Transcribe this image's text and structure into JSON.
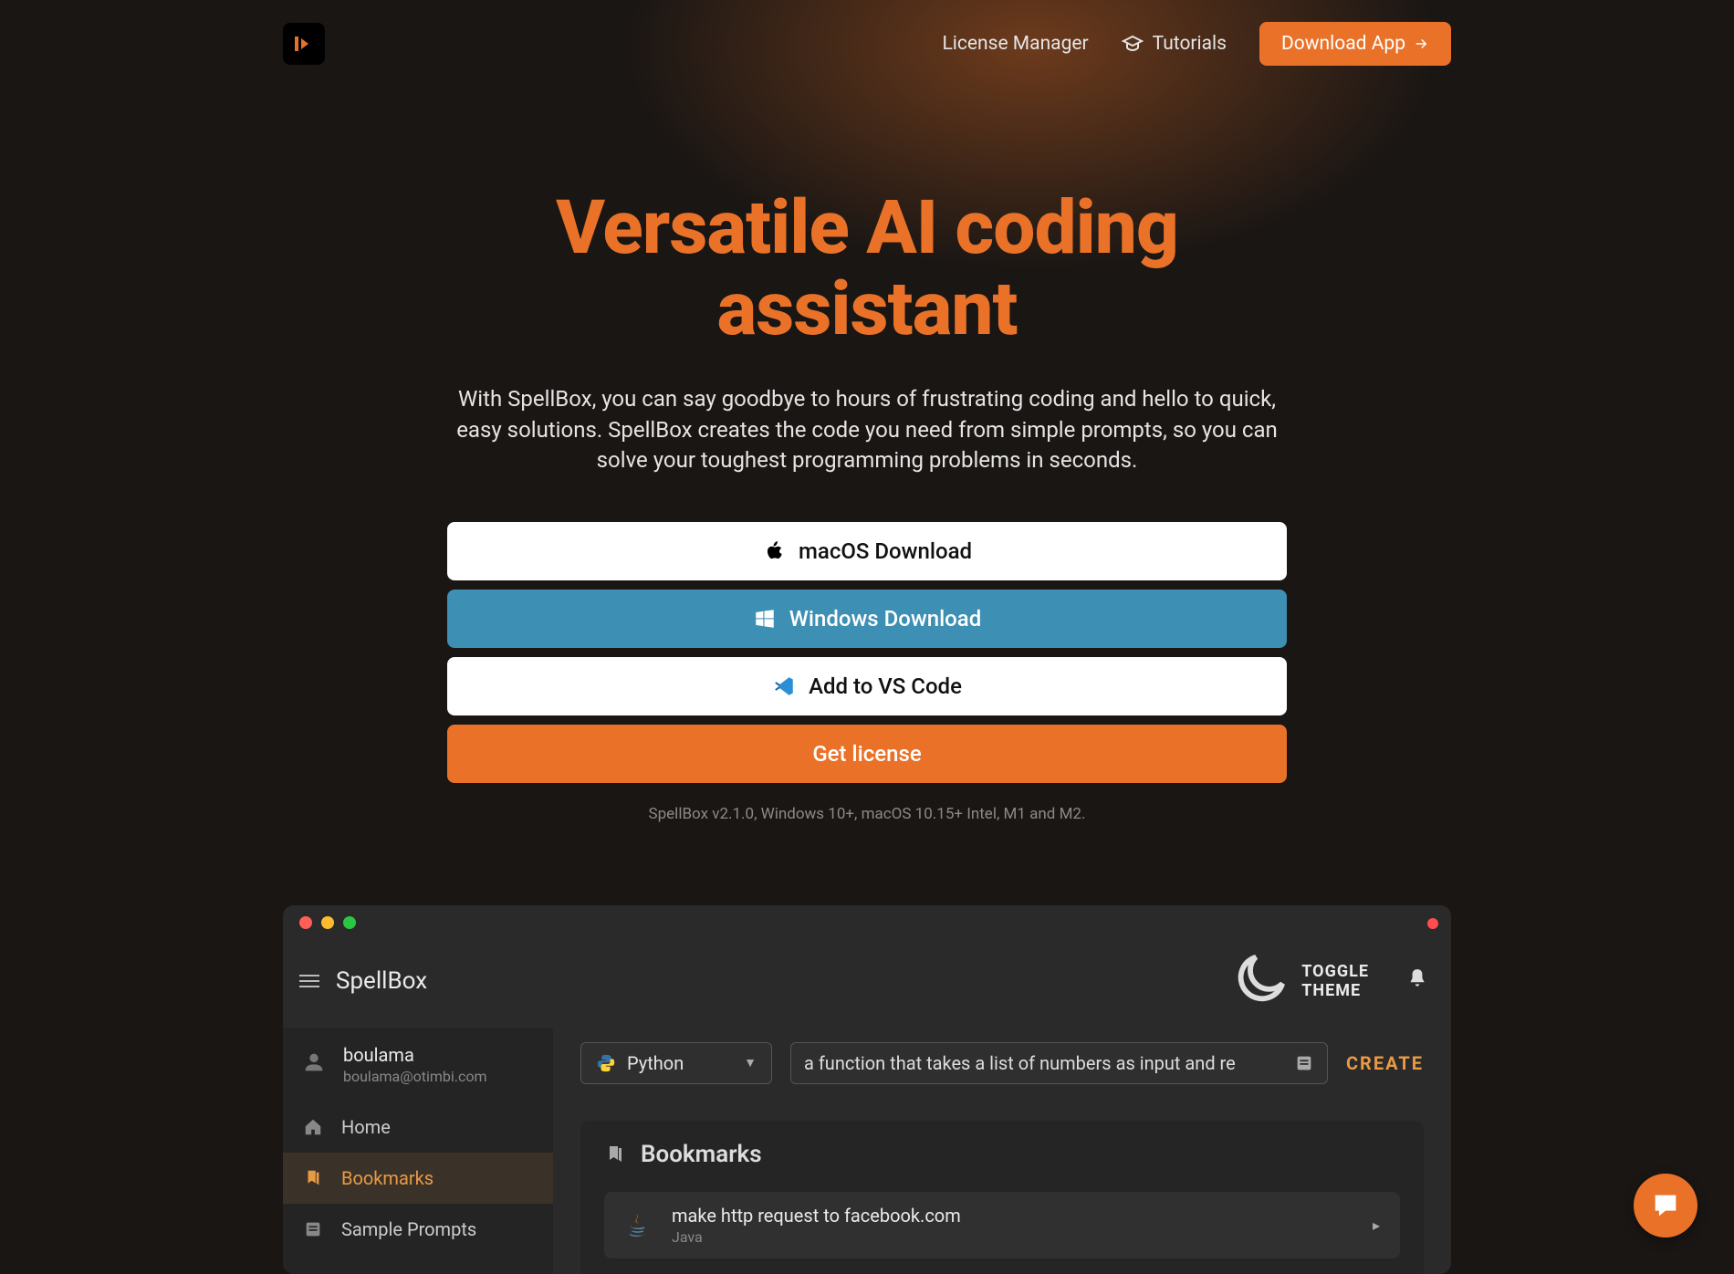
{
  "nav": {
    "license_manager": "License Manager",
    "tutorials": "Tutorials",
    "download_app": "Download App"
  },
  "hero": {
    "title_line1": "Versatile AI coding",
    "title_line2": "assistant",
    "subtitle": "With SpellBox, you can say goodbye to hours of frustrating coding and hello to quick, easy solutions. SpellBox creates the code you need from simple prompts, so you can solve your toughest programming problems in seconds."
  },
  "cta": {
    "macos": "macOS Download",
    "windows": "Windows Download",
    "vscode": "Add to VS Code",
    "license": "Get license",
    "compat": "SpellBox v2.1.0, Windows 10+, macOS 10.15+ Intel, M1 and M2."
  },
  "app": {
    "title": "SpellBox",
    "toggle_theme": "TOGGLE THEME",
    "user": {
      "name": "boulama",
      "email": "boulama@otimbi.com"
    },
    "sidebar": {
      "home": "Home",
      "bookmarks": "Bookmarks",
      "sample_prompts": "Sample Prompts"
    },
    "toolbar": {
      "language": "Python",
      "prompt": "a function that takes a list of numbers as input and re",
      "create": "CREATE"
    },
    "bookmarks": {
      "title": "Bookmarks",
      "item1": {
        "title": "make http request to facebook.com",
        "lang": "Java"
      }
    }
  },
  "colors": {
    "accent": "#ea7228",
    "blue": "#3d8fb3"
  }
}
